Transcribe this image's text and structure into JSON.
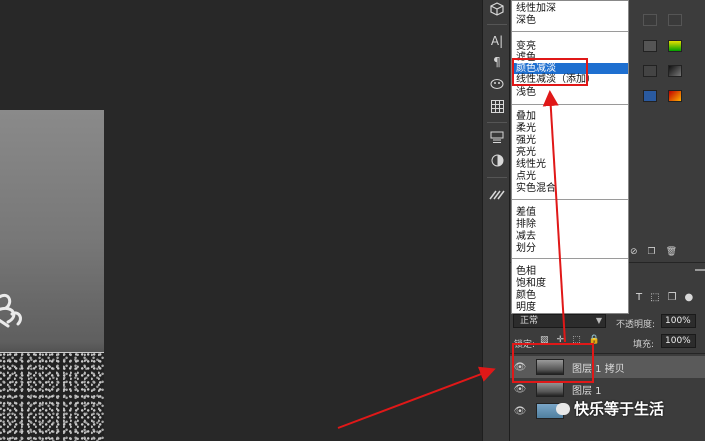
{
  "blend_menu": {
    "items_group1": [
      "线性加深",
      "深色"
    ],
    "items_group2": [
      "变亮",
      "滤色",
      "颜色减淡",
      "线性减淡（添加）",
      "浅色"
    ],
    "selected": "颜色减淡",
    "items_group3": [
      "叠加",
      "柔光",
      "强光",
      "亮光",
      "线性光",
      "点光",
      "实色混合"
    ],
    "items_group4": [
      "差值",
      "排除",
      "减去",
      "划分"
    ],
    "items_group5": [
      "色相",
      "饱和度",
      "颜色",
      "明度"
    ]
  },
  "layers_panel": {
    "blend_mode_value": "正常",
    "opacity_label": "不透明度:",
    "opacity_value": "100%",
    "lock_label": "锁定:",
    "fill_label": "填充:",
    "fill_value": "100%",
    "layers": [
      {
        "name": "图层 1 拷贝",
        "visible": true,
        "selected": true
      },
      {
        "name": "图层 1",
        "visible": true,
        "selected": false
      },
      {
        "name": "",
        "visible": true,
        "selected": false
      }
    ]
  },
  "watermark": {
    "text": "快乐等于生活"
  },
  "colors": {
    "annotation_red": "#e01818",
    "selection_blue": "#1e6fd0"
  }
}
